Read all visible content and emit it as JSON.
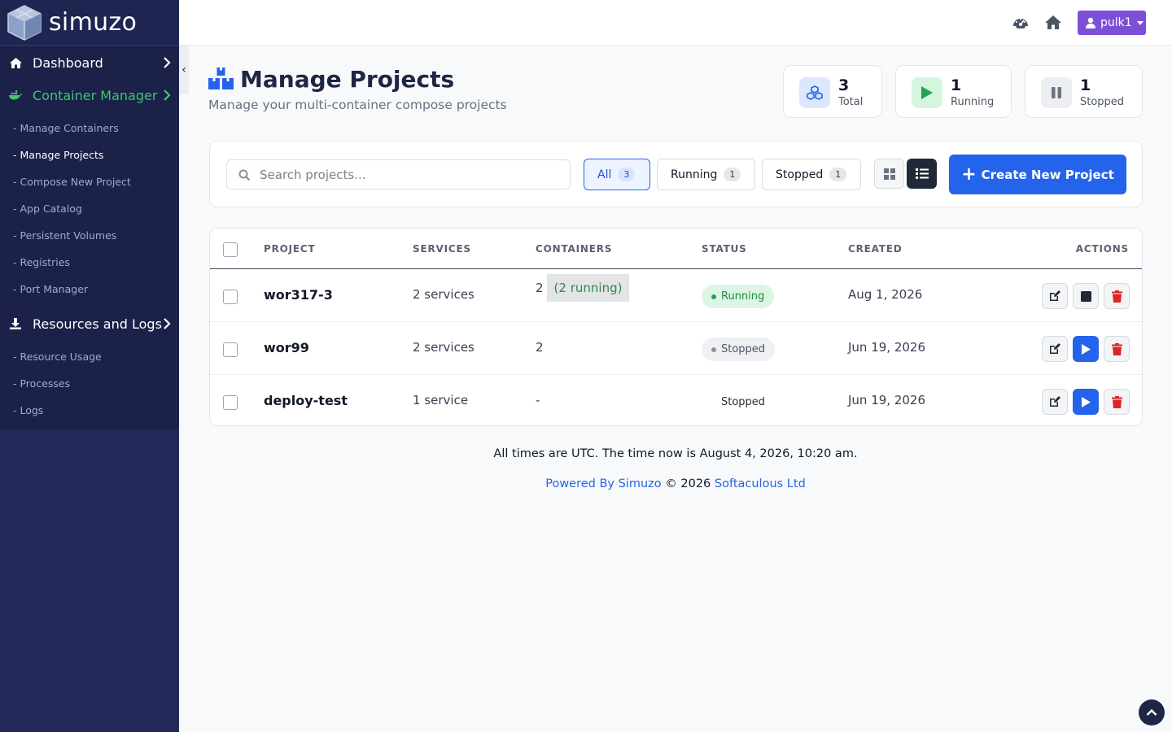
{
  "brand": {
    "name": "simuzo"
  },
  "sidebar": {
    "dashboard_label": "Dashboard",
    "container_manager_label": "Container Manager",
    "container_sub": [
      "- Manage Containers",
      "- Manage Projects",
      "- Compose New Project",
      "- App Catalog",
      "- Persistent Volumes",
      "- Registries",
      "- Port Manager"
    ],
    "resources_label": "Resources and Logs",
    "resources_sub": [
      "- Resource Usage",
      "- Processes",
      "- Logs"
    ],
    "collapse_glyph": "‹",
    "accent_color": "#3ec76e"
  },
  "topbar": {
    "user_label": "pulk1"
  },
  "header": {
    "title": "Manage Projects",
    "subtitle": "Manage your multi-container compose projects"
  },
  "stats": {
    "total": {
      "value": "3",
      "label": "Total"
    },
    "running": {
      "value": "1",
      "label": "Running"
    },
    "stopped": {
      "value": "1",
      "label": "Stopped"
    }
  },
  "toolbar": {
    "search_placeholder": "Search projects...",
    "filters": {
      "all": {
        "label": "All",
        "count": "3"
      },
      "running": {
        "label": "Running",
        "count": "1"
      },
      "stopped": {
        "label": "Stopped",
        "count": "1"
      }
    },
    "create_plus": "+",
    "create_label": "Create New Project"
  },
  "table": {
    "headers": {
      "project": "PROJECT",
      "services": "SERVICES",
      "containers": "CONTAINERS",
      "status": "STATUS",
      "created": "CREATED",
      "actions": "ACTIONS"
    },
    "rows": [
      {
        "name": "wor317-3",
        "services": "2 services",
        "containers": "2",
        "containers_note": "(2 running)",
        "status": "Running",
        "created": "Aug 1, 2026"
      },
      {
        "name": "wor99",
        "services": "2 services",
        "containers": "2",
        "status": "Stopped",
        "created": "Jun 19, 2026"
      },
      {
        "name": "deploy-test",
        "services": "1 service",
        "containers": "-",
        "status": "Stopped",
        "created": "Jun 19, 2026"
      }
    ]
  },
  "footer": {
    "time_note": "All times are UTC. The time now is August 4, 2026, 10:20 am.",
    "powered_by": "Powered By Simuzo",
    "copyright": "© 2026",
    "company": "Softaculous Ltd"
  }
}
